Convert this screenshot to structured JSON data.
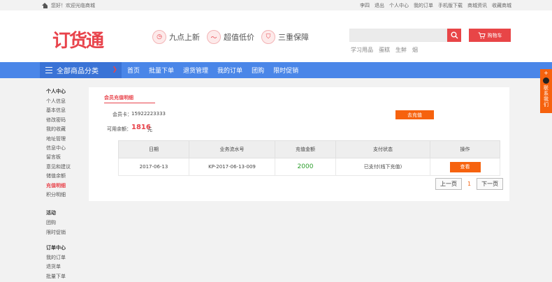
{
  "topbar": {
    "greeting": "您好！欢迎光临商城",
    "links": [
      "李四",
      "退出",
      "个人中心",
      "我的订单",
      "手机版下载",
      "商城资讯",
      "收藏商城"
    ]
  },
  "header": {
    "logo": "订货通",
    "promos": [
      {
        "icon": "clock-icon",
        "glyph": "◷",
        "label": "九点上新"
      },
      {
        "icon": "price-icon",
        "glyph": "〜",
        "label": "超值低价"
      },
      {
        "icon": "shield-icon",
        "glyph": "⛉",
        "label": "三重保障"
      }
    ],
    "search_placeholder": "",
    "cart_label": "购物车",
    "hotwords": [
      "学习用品",
      "蛋糕",
      "生鲜",
      "烟"
    ]
  },
  "nav": {
    "category_label": "全部商品分类",
    "links": [
      "首页",
      "批量下单",
      "退货管理",
      "我的订单",
      "团购",
      "限时促销"
    ]
  },
  "sidebar": {
    "sections": [
      {
        "title": "个人中心",
        "items": [
          "个人信息",
          "基本信息",
          "修改密码",
          "我的收藏",
          "地址管理",
          "信息中心",
          "留言板",
          "意见和建议",
          "储值余额",
          "充值明细",
          "积分明细"
        ],
        "active": "充值明细"
      },
      {
        "title": "活动",
        "items": [
          "团购",
          "限时促销"
        ]
      },
      {
        "title": "订单中心",
        "items": [
          "我的订单",
          "退货单",
          "批量下单"
        ]
      }
    ]
  },
  "main": {
    "title": "会员充值明细",
    "card_label": "会员卡：",
    "card_number": "15922223333",
    "recharge_button": "去充值",
    "balance_label": "可用余额：",
    "balance_value": "1816",
    "balance_unit": "元",
    "table": {
      "headers": [
        "日期",
        "业务流水号",
        "充值金额",
        "支付状态",
        "操作"
      ],
      "rows": [
        {
          "date": "2017-06-13",
          "serial": "KP-2017-06-13-009",
          "amount": "2000",
          "status": "已支付(线下充值)",
          "action": "查看"
        }
      ]
    },
    "pager": {
      "prev": "上一页",
      "current": "1",
      "next": "下一页"
    }
  },
  "float_panel": {
    "plus": "+",
    "label": "联系我们"
  },
  "colors": {
    "accent_red": "#e8434b",
    "nav_blue": "#4a86e8",
    "orange": "#f6620e",
    "amount_green": "#2a9d2a"
  }
}
